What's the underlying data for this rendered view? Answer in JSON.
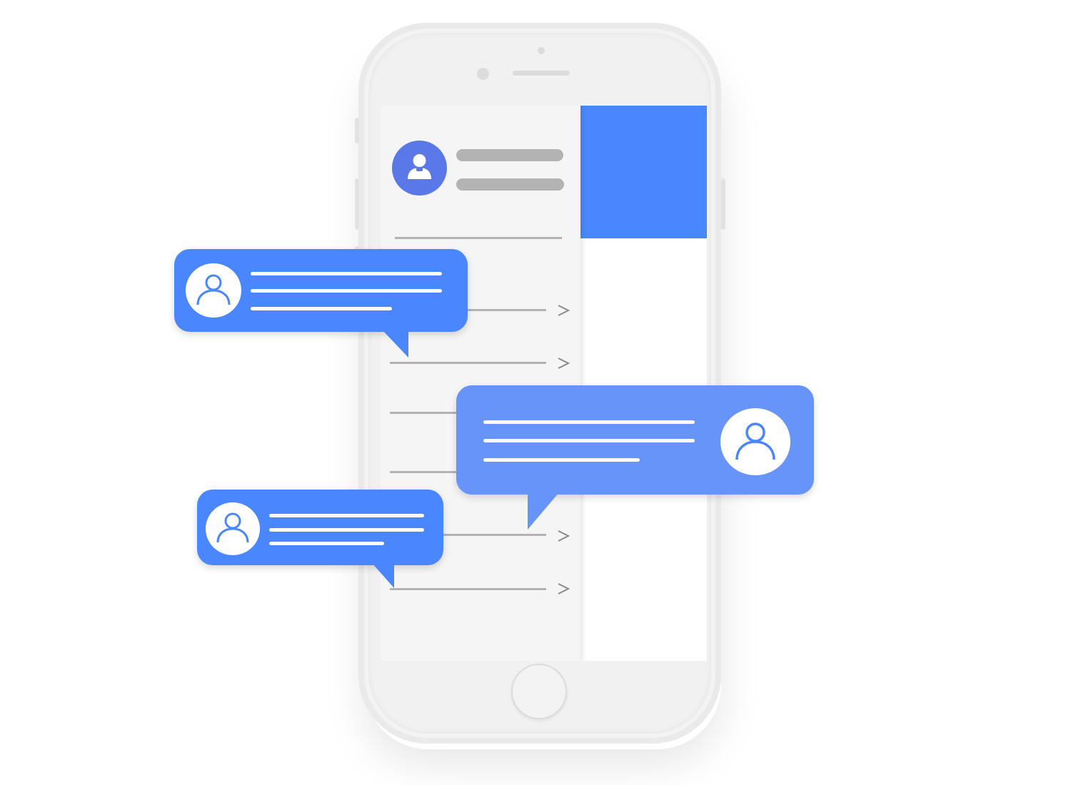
{
  "colors": {
    "accent_blue": "#4a87ff",
    "accent_blue_light": "#6794f8",
    "drawer_avatar": "#5b78e8",
    "placeholder_gray": "#b3b3b3",
    "phone_body": "#eaeaea"
  },
  "icons": {
    "drawer_avatar": "user-icon",
    "bubble_avatar": "user-outline-icon",
    "menu_chevron": "chevron-right-icon"
  }
}
